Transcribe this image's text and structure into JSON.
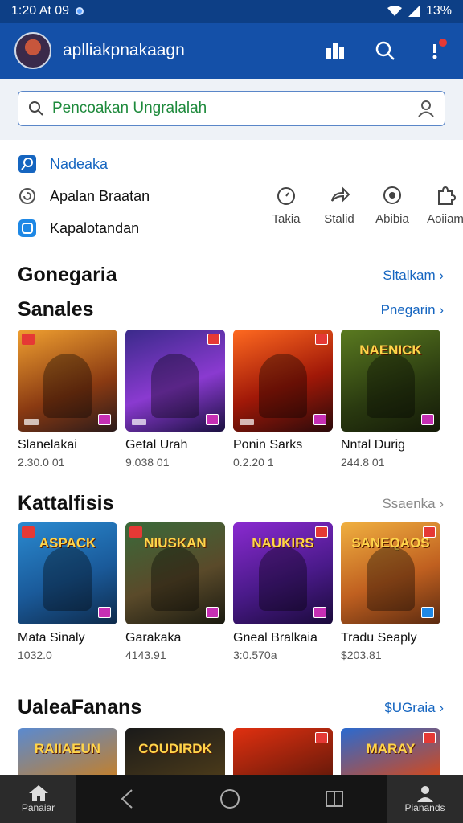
{
  "status": {
    "time": "1:20 At 09",
    "battery": "13%"
  },
  "header": {
    "title": "aplliakpnakaagn",
    "icons": [
      "chart-icon",
      "search-icon",
      "notification-icon"
    ]
  },
  "search": {
    "value": "Pencoakan Ungralalah"
  },
  "menu": [
    {
      "label": "Nadeaka",
      "icon": "search-tile-icon"
    },
    {
      "label": "Apalan Braatan",
      "icon": "refresh-icon"
    },
    {
      "label": "Kapalotandan",
      "icon": "app-tile-icon"
    }
  ],
  "quick": [
    {
      "label": "Takia",
      "icon": "timer-icon"
    },
    {
      "label": "Stalid",
      "icon": "share-icon"
    },
    {
      "label": "Abibia",
      "icon": "badge-icon"
    },
    {
      "label": "Aoiiam",
      "icon": "puzzle-icon"
    }
  ],
  "sections": [
    {
      "title": "Gonegaria",
      "link": "Sltalkam ›"
    },
    {
      "title": "Sanales",
      "link": "Pnegarin ›",
      "items": [
        {
          "name": "Slanelakai",
          "meta": "2.30.0 01"
        },
        {
          "name": "Getal Urah",
          "meta": "9.038 01"
        },
        {
          "name": "Ponin Sarks",
          "meta": "0.2.20 1"
        },
        {
          "name": "Nntal Durig",
          "meta": "244.8 01",
          "banner": "NAENICK"
        }
      ]
    },
    {
      "title": "Kattalfisis",
      "link": "Ssaenka ›",
      "items": [
        {
          "name": "Mata Sinaly",
          "meta": "1032.0",
          "banner": "ASPACK"
        },
        {
          "name": "Garakaka",
          "meta": "4143.91",
          "banner": "NIUSKAN"
        },
        {
          "name": "Gneal Bralkaia",
          "meta": "3:0.570a",
          "banner": "NAUKIRS"
        },
        {
          "name": "Tradu Seaply",
          "meta": "$203.81",
          "banner": "SANEQAOS"
        }
      ]
    },
    {
      "title": "UaleaFanans",
      "link": "$UGraia ›",
      "items": [
        {
          "banner": "RAIIAEUN"
        },
        {
          "banner": "COUDIRDK"
        },
        {
          "banner": ""
        },
        {
          "banner": "MARAY"
        }
      ]
    }
  ],
  "navbar": {
    "left_label": "Panaiar",
    "right_label": "Pianands"
  },
  "colors": {
    "appbar": "#1450a8",
    "statusbar": "#0d3f86",
    "accent": "#1565c0"
  }
}
